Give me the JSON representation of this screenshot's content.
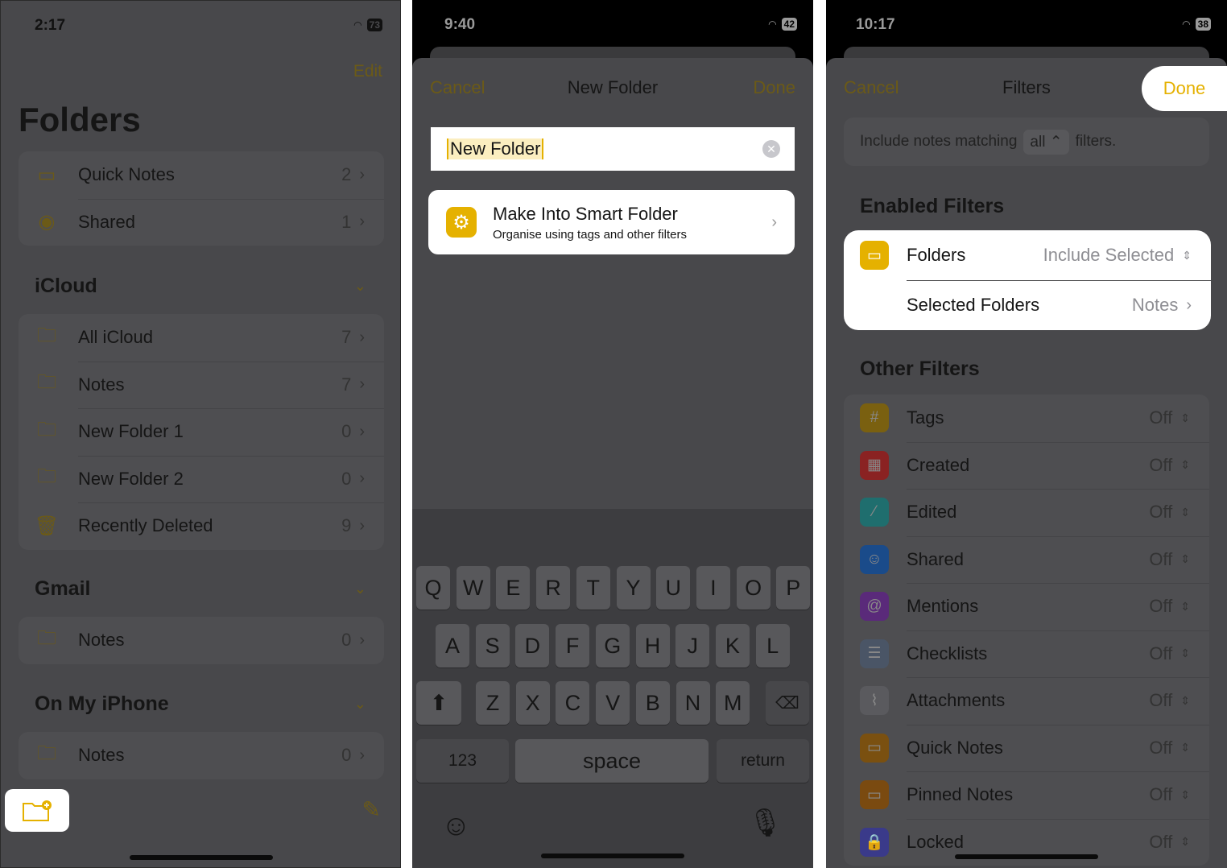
{
  "colors": {
    "accent": "#e5b100",
    "accent_dimmed": "#6b5a17",
    "dim_background": "#48484b"
  },
  "panel1": {
    "status": {
      "time": "2:17",
      "battery": "73"
    },
    "edit_label": "Edit",
    "title": "Folders",
    "top_items": [
      {
        "label": "Quick Notes",
        "count": "2",
        "icon": "quick-notes-icon"
      },
      {
        "label": "Shared",
        "count": "1",
        "icon": "shared-person-icon"
      }
    ],
    "sections": [
      {
        "title": "iCloud",
        "items": [
          {
            "label": "All iCloud",
            "count": "7",
            "icon": "folder-icon"
          },
          {
            "label": "Notes",
            "count": "7",
            "icon": "folder-icon"
          },
          {
            "label": "New Folder 1",
            "count": "0",
            "icon": "folder-icon"
          },
          {
            "label": "New Folder 2",
            "count": "0",
            "icon": "folder-icon"
          },
          {
            "label": "Recently Deleted",
            "count": "9",
            "icon": "trash-icon"
          }
        ]
      },
      {
        "title": "Gmail",
        "items": [
          {
            "label": "Notes",
            "count": "0",
            "icon": "folder-icon"
          }
        ]
      },
      {
        "title": "On My iPhone",
        "items": [
          {
            "label": "Notes",
            "count": "0",
            "icon": "folder-icon"
          }
        ]
      }
    ]
  },
  "panel2": {
    "status": {
      "time": "9:40",
      "battery": "42"
    },
    "cancel_label": "Cancel",
    "title": "New Folder",
    "done_label": "Done",
    "name_input": {
      "value": "New Folder"
    },
    "smart_folder": {
      "title": "Make Into Smart Folder",
      "subtitle": "Organise using tags and other filters"
    },
    "keyboard": {
      "row1": [
        "Q",
        "W",
        "E",
        "R",
        "T",
        "Y",
        "U",
        "I",
        "O",
        "P"
      ],
      "row2": [
        "A",
        "S",
        "D",
        "F",
        "G",
        "H",
        "J",
        "K",
        "L"
      ],
      "row3": [
        "Z",
        "X",
        "C",
        "V",
        "B",
        "N",
        "M"
      ],
      "numbers": "123",
      "space": "space",
      "return": "return"
    }
  },
  "panel3": {
    "status": {
      "time": "10:17",
      "battery": "38"
    },
    "cancel_label": "Cancel",
    "title": "Filters",
    "done_label": "Done",
    "match": {
      "prefix": "Include notes matching",
      "value": "all",
      "suffix": "filters."
    },
    "enabled_title": "Enabled Filters",
    "enabled": [
      {
        "label": "Folders",
        "value": "Include Selected"
      },
      {
        "label": "Selected Folders",
        "value": "Notes"
      }
    ],
    "other_title": "Other Filters",
    "other": [
      {
        "label": "Tags",
        "value": "Off",
        "icon": "hash-icon",
        "color": "#7a6010",
        "glyph": "#"
      },
      {
        "label": "Created",
        "value": "Off",
        "icon": "calendar-icon",
        "color": "#8a2222",
        "glyph": "▦"
      },
      {
        "label": "Edited",
        "value": "Off",
        "icon": "pencil-icon",
        "color": "#1f6e6e",
        "glyph": "⁄"
      },
      {
        "label": "Shared",
        "value": "Off",
        "icon": "shared-icon",
        "color": "#1a4b8a",
        "glyph": "☺"
      },
      {
        "label": "Mentions",
        "value": "Off",
        "icon": "at-icon",
        "color": "#5a2a7a",
        "glyph": "@"
      },
      {
        "label": "Checklists",
        "value": "Off",
        "icon": "checklist-icon",
        "color": "#4a5566",
        "glyph": "☰"
      },
      {
        "label": "Attachments",
        "value": "Off",
        "icon": "paperclip-icon",
        "color": "#5a5a5e",
        "glyph": "⌇"
      },
      {
        "label": "Quick Notes",
        "value": "Off",
        "icon": "quick-notes-icon",
        "color": "#7a5010",
        "glyph": "▭"
      },
      {
        "label": "Pinned Notes",
        "value": "Off",
        "icon": "pin-icon",
        "color": "#7a4a10",
        "glyph": "▭"
      },
      {
        "label": "Locked",
        "value": "Off",
        "icon": "lock-icon",
        "color": "#3a3a8a",
        "glyph": "🔒"
      }
    ]
  }
}
